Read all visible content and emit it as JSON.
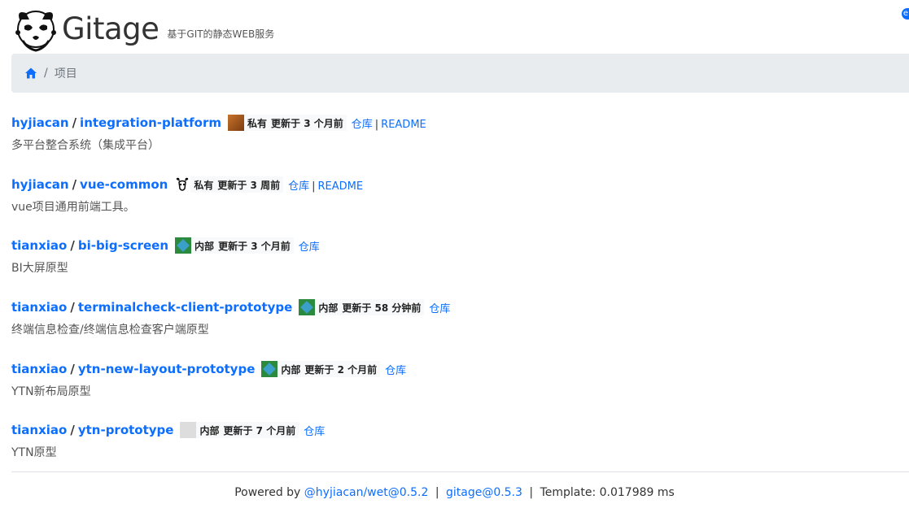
{
  "header": {
    "title": "Gitage",
    "subtitle": "基于GIT的静态WEB服务"
  },
  "breadcrumb": {
    "home_icon": "home-icon",
    "separator": "/",
    "current": "项目"
  },
  "repos": [
    {
      "owner": "hyjiacan",
      "name": "integration-platform",
      "visibility": "私有",
      "updated": "更新于 3 个月前",
      "repo_link": "仓库",
      "readme_link": "README",
      "description": "多平台整合系统（集成平台）"
    },
    {
      "owner": "hyjiacan",
      "name": "vue-common",
      "visibility": "私有",
      "updated": "更新于 3 周前",
      "repo_link": "仓库",
      "readme_link": "README",
      "description": "vue项目通用前端工具。"
    },
    {
      "owner": "tianxiao",
      "name": "bi-big-screen",
      "visibility": "内部",
      "updated": "更新于 3 个月前",
      "repo_link": "仓库",
      "description": "BI大屏原型"
    },
    {
      "owner": "tianxiao",
      "name": "terminalcheck-client-prototype",
      "visibility": "内部",
      "updated": "更新于 58 分钟前",
      "repo_link": "仓库",
      "description": "终端信息检查/终端信息检查客户端原型"
    },
    {
      "owner": "tianxiao",
      "name": "ytn-new-layout-prototype",
      "visibility": "内部",
      "updated": "更新于 2 个月前",
      "repo_link": "仓库",
      "description": "YTN新布局原型"
    },
    {
      "owner": "tianxiao",
      "name": "ytn-prototype",
      "visibility": "内部",
      "updated": "更新于 7 个月前",
      "repo_link": "仓库",
      "description": "YTN原型"
    }
  ],
  "footer": {
    "powered_by": "Powered by",
    "wet_link": "@hyjiacan/wet@0.5.2",
    "gitage_link": "gitage@0.5.3",
    "template_time": "Template: 0.017989 ms",
    "separator": "|"
  }
}
